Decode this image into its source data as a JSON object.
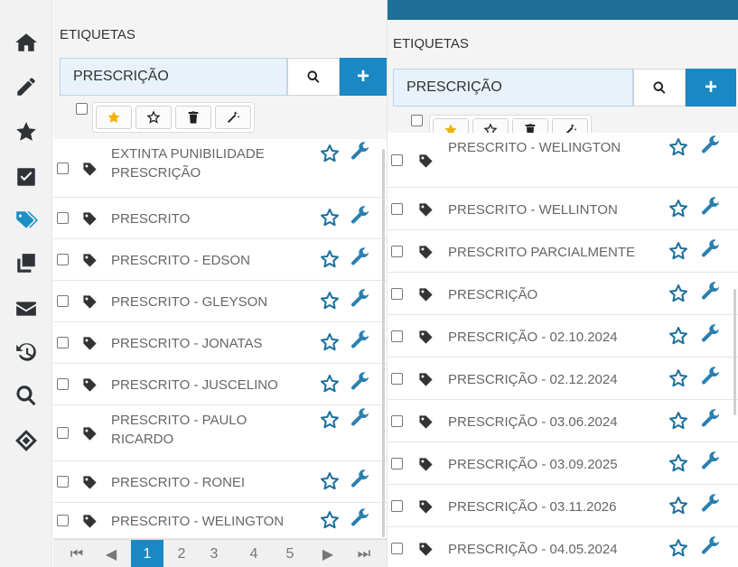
{
  "sidebar": {
    "items": [
      {
        "icon": "home-icon"
      },
      {
        "icon": "pencil-icon"
      },
      {
        "icon": "star-icon"
      },
      {
        "icon": "checkbox-icon"
      },
      {
        "icon": "tags-icon",
        "active": true
      },
      {
        "icon": "copy-icon"
      },
      {
        "icon": "envelope-icon"
      },
      {
        "icon": "history-icon"
      },
      {
        "icon": "search-icon"
      },
      {
        "icon": "logo-icon"
      }
    ]
  },
  "left_panel": {
    "title": "ETIQUETAS",
    "search_value": "PRESCRIÇÃO",
    "add_label": "+",
    "rows": [
      {
        "label": "EXTINTA PUNIBILIDADE PRESCRIÇÃO"
      },
      {
        "label": "PRESCRITO"
      },
      {
        "label": "PRESCRITO - EDSON"
      },
      {
        "label": "PRESCRITO - GLEYSON"
      },
      {
        "label": "PRESCRITO - JONATAS"
      },
      {
        "label": "PRESCRITO - JUSCELINO"
      },
      {
        "label": "PRESCRITO - PAULO RICARDO"
      },
      {
        "label": "PRESCRITO - RONEI"
      },
      {
        "label": "PRESCRITO - WELINGTON"
      }
    ],
    "pager": {
      "first": "⏮",
      "prev": "◀",
      "pages": [
        "1",
        "2",
        "3",
        "4",
        "5"
      ],
      "current": "1",
      "next": "▶",
      "last": "⏭"
    }
  },
  "right_panel": {
    "title": "ETIQUETAS",
    "search_value": "PRESCRIÇÃO",
    "add_label": "+",
    "rows": [
      {
        "label": "PRESCRITO - WELINGTON"
      },
      {
        "label": "PRESCRITO - WELLINTON"
      },
      {
        "label": "PRESCRITO PARCIALMENTE"
      },
      {
        "label": "PRESCRIÇÃO"
      },
      {
        "label": "PRESCRIÇÃO - 02.10.2024"
      },
      {
        "label": "PRESCRIÇÃO - 02.12.2024"
      },
      {
        "label": "PRESCRIÇÃO - 03.06.2024"
      },
      {
        "label": "PRESCRIÇÃO - 03.09.2025"
      },
      {
        "label": "PRESCRIÇÃO - 03.11.2026"
      },
      {
        "label": "PRESCRIÇÃO - 04.05.2024"
      }
    ]
  },
  "colors": {
    "accent": "#1a88c2",
    "star_outline": "#1b6f9c",
    "wrench": "#2a7fb0",
    "star_filled": "#f2b200"
  }
}
